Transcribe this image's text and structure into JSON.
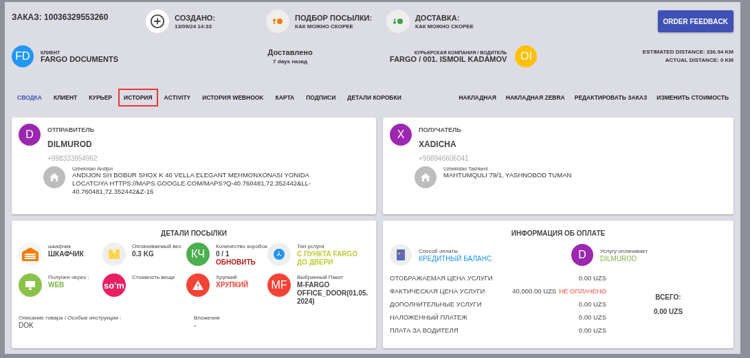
{
  "order": {
    "label": "ЗАКАЗ:",
    "number": "10036329553260"
  },
  "milestones": [
    {
      "kind": "created",
      "title": "СОЗДАНО:",
      "value": "13/09/24 14:33"
    },
    {
      "kind": "pickup",
      "title": "ПОДБОР ПОСЫЛКИ:",
      "value": "КАК МОЖНО СКОРЕЕ"
    },
    {
      "kind": "delivery",
      "title": "ДОСТАВКА:",
      "value": "КАК МОЖНО СКОРЕЕ"
    }
  ],
  "feedback_button": "ORDER FEEDBACK",
  "client": {
    "initials": "FD",
    "label": "КЛИЕНТ",
    "name": "FARGO DOCUMENTS"
  },
  "status": {
    "title": "Доставлено",
    "ago": "7 days назад"
  },
  "courier": {
    "label": "КУРЬЕРСКАЯ КОМПАНИЯ / ВОДИТЕЛЬ",
    "name": "FARGO / 001. ISMOIL KADAMOV",
    "initials": "OI"
  },
  "distances": [
    "ESTIMATED DISTANCE: 336.94 KM",
    "ACTUAL DISTANCE: 0 KM"
  ],
  "tabs": [
    {
      "label": "СВОДКА",
      "selected": true,
      "highlighted": false
    },
    {
      "label": "КЛИЕНТ",
      "selected": false,
      "highlighted": false
    },
    {
      "label": "КУРЬЕР",
      "selected": false,
      "highlighted": false
    },
    {
      "label": "ИСТОРИЯ",
      "selected": false,
      "highlighted": true
    },
    {
      "label": "ACTIVITY",
      "selected": false,
      "highlighted": false
    },
    {
      "label": "ИСТОРИЯ WEBHOOK",
      "selected": false,
      "highlighted": false
    },
    {
      "label": "КАРТА",
      "selected": false,
      "highlighted": false
    },
    {
      "label": "ПОДПИСИ",
      "selected": false,
      "highlighted": false
    },
    {
      "label": "ДЕТАЛИ КОРОБКИ",
      "selected": false,
      "highlighted": false
    }
  ],
  "actions": [
    "НАКЛАДНАЯ",
    "НАКЛАДНАЯ ZEBRA",
    "РЕДАКТИРОВАТЬ ЗАКАЗ",
    "ИЗМЕНИТЬ СТОИМОСТЬ"
  ],
  "parties": [
    {
      "initial": "D",
      "role": "ОТПРАВИТЕЛЬ",
      "name": "DILMUROD",
      "phone": "+998333954962",
      "region": "Uzbekistan Andijon",
      "address": "ANDIJON SH BOBUR SHOX K 40 VELLA ELEGANT MEHMONXONASI YONIDA LOCATCIYA HTTPS://MAPS.GOOGLE.COM/MAPS?Q-40.760481,72.352442&LL-40.760481,72.352442&Z-16"
    },
    {
      "initial": "X",
      "role": "ПОЛУЧАТЕЛЬ",
      "name": "XADICHA",
      "phone": "+998946606041",
      "region": "Uzbekistan Tashkent",
      "address": "MAHTUMQULI 79/1, YASHNOBOD TUMAN"
    }
  ],
  "parcel": {
    "title": "ДЕТАЛИ ПОСЫЛКИ",
    "items": [
      {
        "kind": "locker",
        "label": "шкафчик",
        "value": "ШКАФЧИК",
        "color": "#444444"
      },
      {
        "kind": "weight",
        "label": "Оплачиваемый вес",
        "value": "0.3 KG",
        "color": "#444444"
      },
      {
        "kind": "count",
        "badge": "КЧ",
        "label": "Количество коробок",
        "value": "0 / 1",
        "link": "ОБНОВИТЬ",
        "color": "#444444"
      },
      {
        "kind": "service",
        "label": "Тип услуги",
        "value": "С ПУНКТА FARGO ДО ДВЕРИ",
        "color": "#c0ca33"
      },
      {
        "kind": "source",
        "label": "Получен через :",
        "value": "WEB",
        "color": "#7cb342"
      },
      {
        "kind": "cost",
        "badge": "so'm",
        "label": "Стоимость вещи"
      },
      {
        "kind": "fragile",
        "label": "Хрупкий",
        "value": "ХРУПКИЙ",
        "color": "#f44336"
      },
      {
        "kind": "package",
        "badge": "MF",
        "label": "Выбранный Пакет",
        "value": "M-FARGO OFFICE_DOOR(01.05.2024)",
        "color": "#444444"
      }
    ],
    "notes": [
      {
        "label": "Описание товара / Особые инструкции :",
        "value": "DOK"
      },
      {
        "label": "Вложения",
        "value": "-"
      }
    ]
  },
  "payment": {
    "title": "ИНФОРМАЦИЯ ОБ ОПЛАТЕ",
    "method_label": "Способ оплаты",
    "method": "КРЕДИТНЫЙ БАЛАНС",
    "payer_initial": "D",
    "payer_label": "Услугу оплачивает",
    "payer": "DILMUROD",
    "rows": [
      {
        "label": "ОТОБРАЖАЕМАЯ ЦЕНА УСЛУГИ",
        "amount": "0.00 UZS"
      },
      {
        "label": "ФАКТИЧЕСКАЯ ЦЕНА УСЛУГИ",
        "amount": "40,000.00 UZS",
        "status": "НЕ ОПЛАЧЕНО"
      },
      {
        "label": "ДОПОЛНИТЕЛЬНЫЕ УСЛУГИ",
        "amount": "0.00 UZS"
      },
      {
        "label": "НАЛОЖЕННЫЙ ПЛАТЕЖ",
        "amount": "0.00 UZS"
      },
      {
        "label": "ПЛАТА ЗА ВОДИТЕЛЯ",
        "amount": "0.00 UZS"
      }
    ],
    "total_label": "ВСЕГО:",
    "total": "0.00 UZS"
  }
}
